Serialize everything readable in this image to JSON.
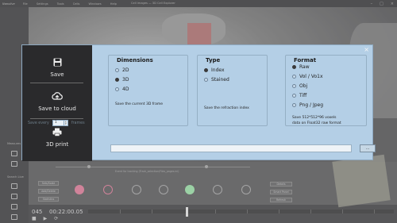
{
  "titlebar": {
    "app": "Nanolive",
    "menus": [
      "File",
      "Settings",
      "Tools",
      "Cells",
      "Windows",
      "Help"
    ],
    "title": "Cell images — 3D Cell Explorer",
    "window_buttons": [
      "–",
      "□",
      "×"
    ]
  },
  "left_tools": {
    "measures_label": "Measures",
    "search_label": "Search Live"
  },
  "bottom": {
    "tracking_text": "Event for tracking (Track_selection/Files_pages.ini)",
    "buttons": [
      "Sets/Scale",
      "Add/Delete",
      "Statistics",
      "Details",
      "Smart Panel",
      "Refresh"
    ],
    "channel_colors": [
      "#d0708c",
      "#d0708c",
      "#9a9a9a",
      "#9a9a9a",
      "#8ed19a",
      "#9a9a9a",
      "#9a9a9a"
    ]
  },
  "timebar": {
    "frame": "045",
    "time": "00:22:00.05",
    "controls": [
      "■",
      "▶",
      "⟳"
    ]
  },
  "dialog": {
    "actions": [
      {
        "label": "Save",
        "icon": "save-icon"
      },
      {
        "label": "Save to cloud",
        "icon": "cloud-upload-icon"
      },
      {
        "label": "3D print",
        "icon": "printer-icon"
      }
    ],
    "close": "×",
    "dimensions": {
      "title": "Dimensions",
      "options": [
        "2D",
        "3D",
        "4D"
      ],
      "selected": "3D",
      "note": "Save the current 3D frame",
      "save_every_label": "Save every",
      "save_every_value": "1",
      "frames_label": "frames"
    },
    "type": {
      "title": "Type",
      "options": [
        "Index",
        "Stained"
      ],
      "selected": "Index",
      "note": "Save the refraction index"
    },
    "format": {
      "title": "Format",
      "options": [
        "Raw",
        "Vol / Vo1x",
        "Obj",
        "Tiff",
        "Png / Jpeg"
      ],
      "selected": "Raw",
      "note_line1": "Save 512*512*96 voxels",
      "note_line2": "data on Float32 raw format"
    },
    "path_value": "",
    "browse_label": "..."
  }
}
